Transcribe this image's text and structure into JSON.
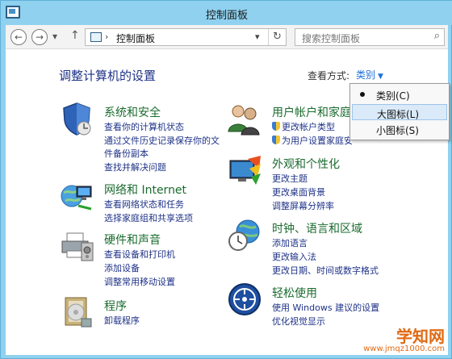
{
  "window": {
    "title": "控制面板"
  },
  "nav": {
    "back": "←",
    "forward": "→",
    "history": "▾",
    "up": "↑",
    "address_sep": "›",
    "address_crumb": "控制面板",
    "address_dropdown": "▾",
    "refresh": "↻",
    "search_placeholder": "搜索控制面板",
    "search_icon": "⌕"
  },
  "main": {
    "heading": "调整计算机的设置",
    "view_by_label": "查看方式:",
    "view_by_value": "类别"
  },
  "view_menu": {
    "items": [
      {
        "label": "类别(C)",
        "selected": true
      },
      {
        "label": "大图标(L)",
        "highlighted": true
      },
      {
        "label": "小图标(S)"
      }
    ]
  },
  "categories": {
    "system_security": {
      "title": "系统和安全",
      "links": [
        "查看你的计算机状态",
        "通过文件历史记录保存你的文",
        "件备份副本",
        "查找并解决问题"
      ]
    },
    "network": {
      "title": "网络和 Internet",
      "links": [
        "查看网络状态和任务",
        "选择家庭组和共享选项"
      ]
    },
    "hardware": {
      "title": "硬件和声音",
      "links": [
        "查看设备和打印机",
        "添加设备",
        "调整常用移动设置"
      ]
    },
    "programs": {
      "title": "程序",
      "links": [
        "卸载程序"
      ]
    },
    "user_accounts": {
      "title": "用户帐户和家庭",
      "links": [
        "更改帐户类型",
        "为用户设置家庭安"
      ]
    },
    "appearance": {
      "title": "外观和个性化",
      "links": [
        "更改主题",
        "更改桌面背景",
        "调整屏幕分辨率"
      ]
    },
    "clock": {
      "title": "时钟、语言和区域",
      "links": [
        "添加语言",
        "更改输入法",
        "更改日期、时间或数字格式"
      ]
    },
    "ease": {
      "title": "轻松使用",
      "links": [
        "使用 Windows 建议的设置",
        "优化视觉显示"
      ]
    }
  },
  "watermark": {
    "big": "学知网",
    "small": "www.jmqz1000.com"
  }
}
